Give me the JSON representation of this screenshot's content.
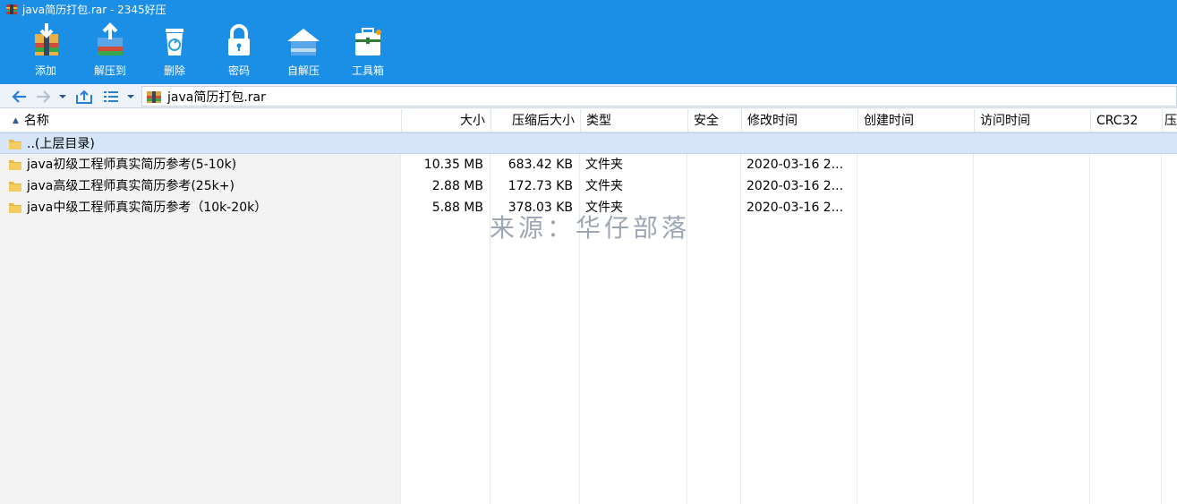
{
  "window": {
    "title": "java简历打包.rar - 2345好压"
  },
  "toolbar": {
    "items": [
      {
        "label": "添加",
        "icon": "add-archive-icon"
      },
      {
        "label": "解压到",
        "icon": "extract-to-icon"
      },
      {
        "label": "删除",
        "icon": "recycle-bin-icon"
      },
      {
        "label": "密码",
        "icon": "padlock-icon"
      },
      {
        "label": "自解压",
        "icon": "self-extract-icon"
      },
      {
        "label": "工具箱",
        "icon": "toolbox-icon"
      }
    ]
  },
  "nav": {
    "path": "java简历打包.rar"
  },
  "columns": {
    "name": "名称",
    "size": "大小",
    "packed": "压缩后大小",
    "type": "类型",
    "security": "安全",
    "modified": "修改时间",
    "created": "创建时间",
    "accessed": "访问时间",
    "crc": "CRC32",
    "extra": "压"
  },
  "rows": [
    {
      "name": "..(上层目录)",
      "size": "",
      "packed": "",
      "type": "",
      "modified": ""
    },
    {
      "name": "java初级工程师真实简历参考(5-10k)",
      "size": "10.35 MB",
      "packed": "683.42 KB",
      "type": "文件夹",
      "modified": "2020-03-16 2..."
    },
    {
      "name": "java高级工程师真实简历参考(25k+)",
      "size": "2.88 MB",
      "packed": "172.73 KB",
      "type": "文件夹",
      "modified": "2020-03-16 2..."
    },
    {
      "name": "java中级工程师真实简历参考（10k-20k）",
      "size": "5.88 MB",
      "packed": "378.03 KB",
      "type": "文件夹",
      "modified": "2020-03-16 2..."
    }
  ],
  "watermark": "来源：华仔部落",
  "colors": {
    "header": "#1b8ee6",
    "selection": "#d6e6f8"
  }
}
